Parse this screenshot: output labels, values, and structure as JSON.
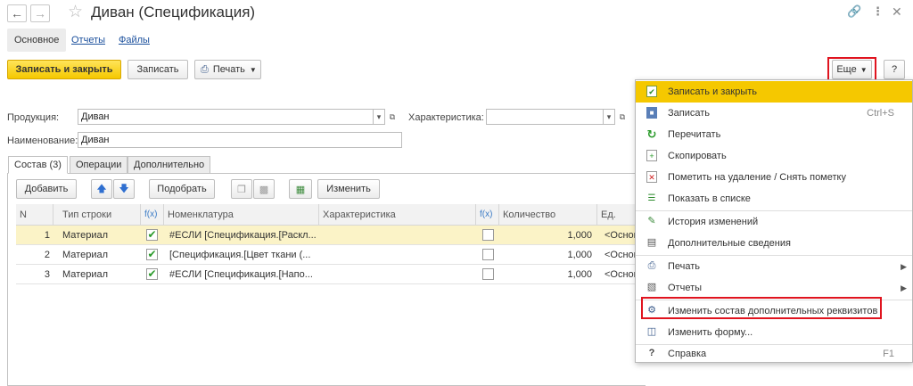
{
  "window": {
    "title": "Диван (Спецификация)",
    "back_icon": "arrow-left-icon",
    "forward_icon": "arrow-right-icon",
    "favorite_icon": "star-icon",
    "link_icon": "link-icon",
    "more_icon": "vertical-dots-icon",
    "close_icon": "close-icon"
  },
  "form_tabs": [
    {
      "label": "Основное",
      "active": true
    },
    {
      "label": "Отчеты",
      "active": false
    },
    {
      "label": "Файлы",
      "active": false
    }
  ],
  "toolbar": {
    "save_close_label": "Записать и закрыть",
    "save_label": "Записать",
    "print_label": "Печать",
    "more_label": "Еще",
    "help_label": "?"
  },
  "fields": {
    "product_label": "Продукция:",
    "product_value": "Диван",
    "characteristic_label": "Характеристика:",
    "characteristic_value": "",
    "name_label": "Наименование:",
    "name_value": "Диван"
  },
  "inner_tabs": [
    {
      "label": "Состав (3)",
      "active": true
    },
    {
      "label": "Операции",
      "active": false
    },
    {
      "label": "Дополнительно",
      "active": false
    }
  ],
  "table_toolbar": {
    "add_label": "Добавить",
    "pick_label": "Подобрать",
    "change_label": "Изменить"
  },
  "table": {
    "columns": [
      "N",
      "Тип строки",
      "Номенклатура",
      "Характеристика",
      "Количество",
      "Ед."
    ],
    "rows": [
      {
        "n": "1",
        "type": "Материал",
        "flag": true,
        "nomenclature": "#ЕСЛИ [Спецификация.[Раскл...",
        "characteristic": "",
        "flag2": false,
        "qty": "1,000",
        "unit": "<Основ",
        "selected": true
      },
      {
        "n": "2",
        "type": "Материал",
        "flag": true,
        "nomenclature": "[Спецификация.[Цвет ткани (...",
        "characteristic": "",
        "flag2": false,
        "qty": "1,000",
        "unit": "<Основ",
        "selected": false
      },
      {
        "n": "3",
        "type": "Материал",
        "flag": true,
        "nomenclature": "#ЕСЛИ [Спецификация.[Напо...",
        "characteristic": "",
        "flag2": false,
        "qty": "1,000",
        "unit": "<Основ",
        "selected": false
      }
    ]
  },
  "menu": {
    "items": [
      {
        "label": "Записать и закрыть",
        "icon": "save-close-icon",
        "shortcut": "",
        "highlighted": true
      },
      {
        "label": "Записать",
        "icon": "floppy-icon",
        "shortcut": "Ctrl+S"
      },
      {
        "label": "Перечитать",
        "icon": "refresh-icon",
        "shortcut": ""
      },
      {
        "label": "Скопировать",
        "icon": "copy-icon",
        "shortcut": ""
      },
      {
        "label": "Пометить на удаление / Снять пометку",
        "icon": "delete-mark-icon",
        "shortcut": ""
      },
      {
        "label": "Показать в списке",
        "icon": "show-in-list-icon",
        "shortcut": ""
      },
      {
        "label": "История изменений",
        "icon": "history-icon",
        "shortcut": ""
      },
      {
        "label": "Дополнительные сведения",
        "icon": "info-doc-icon",
        "shortcut": ""
      },
      {
        "label": "Печать",
        "icon": "printer-icon",
        "shortcut": "",
        "submenu": true
      },
      {
        "label": "Отчеты",
        "icon": "report-icon",
        "shortcut": "",
        "submenu": true
      },
      {
        "label": "Изменить состав дополнительных реквизитов",
        "icon": "edit-attributes-icon",
        "shortcut": "",
        "boxed": true
      },
      {
        "label": "Изменить форму...",
        "icon": "edit-form-icon",
        "shortcut": ""
      },
      {
        "label": "Справка",
        "icon": "help-icon",
        "shortcut": "F1"
      }
    ]
  },
  "colors": {
    "accent_yellow": "#f5c800",
    "highlight_red": "#e0141f",
    "selected_row": "#fbf3c7",
    "link_blue": "#1a4f9c"
  }
}
